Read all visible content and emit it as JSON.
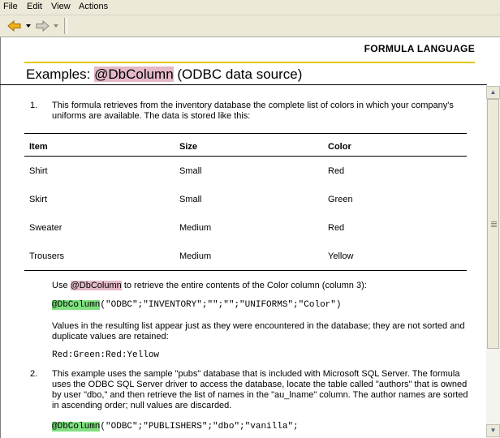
{
  "menubar": {
    "file": "File",
    "edit": "Edit",
    "view": "View",
    "actions": "Actions"
  },
  "toolbar": {
    "icons": [
      "back-arrow-icon",
      "forward-arrow-icon"
    ]
  },
  "doc": {
    "section_header": "FORMULA LANGUAGE",
    "title_prefix": "Examples: ",
    "title_func": "@DbColumn",
    "title_suffix": " (ODBC data source)",
    "item1_num": "1.",
    "item1_text": "This formula retrieves from the inventory database the complete list of colors in which your company's uniforms are available. The data is stored like this:",
    "table": {
      "headers": [
        "Item",
        "Size",
        "Color"
      ],
      "rows": [
        [
          "Shirt",
          "Small",
          "Red"
        ],
        [
          "Skirt",
          "Small",
          "Green"
        ],
        [
          "Sweater",
          "Medium",
          "Red"
        ],
        [
          "Trousers",
          "Medium",
          "Yellow"
        ]
      ]
    },
    "use_prefix": "Use ",
    "use_func": "@DbColumn",
    "use_suffix": " to retrieve the entire contents of the Color column (column 3):",
    "code1_func": "@DbColumn",
    "code1_args": "(\"ODBC\";\"INVENTORY\";\"\";\"\";\"UNIFORMS\";\"Color\")",
    "values_text": "Values in the resulting list appear just as they were encountered in the database; they are not sorted and duplicate values are retained:",
    "result_line": "Red:Green:Red:Yellow",
    "item2_num": "2.",
    "item2_text": "This example uses the sample \"pubs\" database that is included with Microsoft SQL Server. The formula uses the ODBC SQL Server driver to access the database, locate the table called \"authors\" that is owned by user \"dbo,\" and then retrieve the list of names in the \"au_lname\" column. The author names are sorted in ascending order; null values are discarded.",
    "code2_func": "@DbColumn",
    "code2_args": "(\"ODBC\";\"PUBLISHERS\";\"dbo\";\"vanilla\";"
  },
  "colors": {
    "accent_rule": "#e8c700",
    "func_highlight": "#e4b8c9",
    "code_highlight": "#7ee07e"
  }
}
